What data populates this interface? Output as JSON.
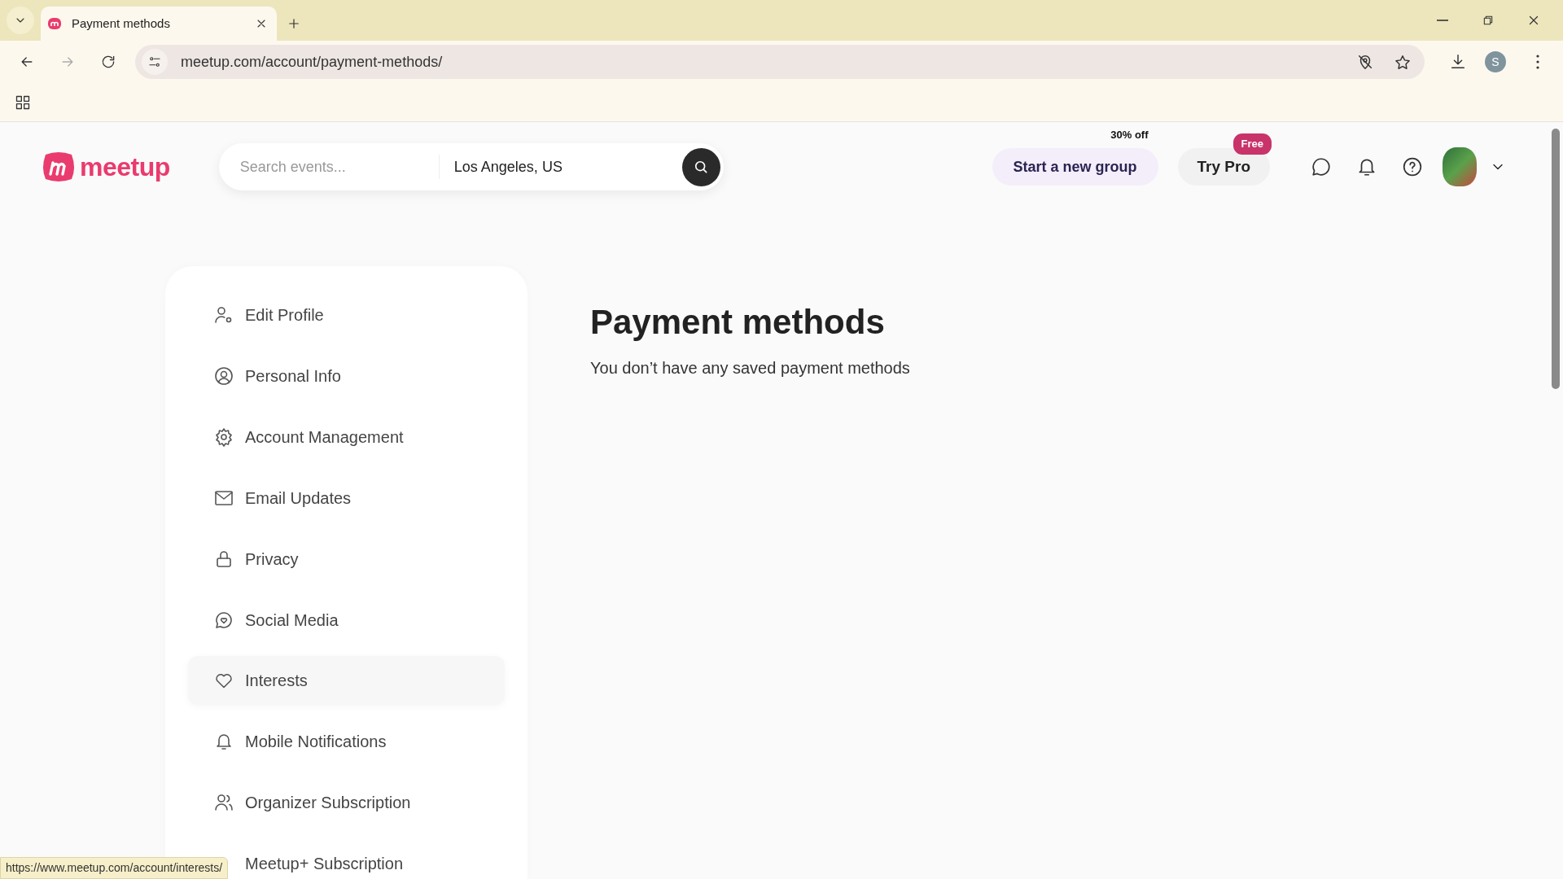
{
  "browser": {
    "tab": {
      "title": "Payment methods"
    },
    "address": "meetup.com/account/payment-methods/",
    "profile_initial": "S",
    "status_url": "https://www.meetup.com/account/interests/"
  },
  "header": {
    "logo": "meetup",
    "search": {
      "placeholder": "Search events..."
    },
    "location": "Los Angeles, US",
    "start_group": {
      "label": "Start a new group",
      "badge": "30% off"
    },
    "try_pro": {
      "label": "Try Pro",
      "badge": "Free"
    }
  },
  "sidebar": {
    "items": [
      {
        "label": "Edit Profile",
        "highlighted": false
      },
      {
        "label": "Personal Info",
        "highlighted": false
      },
      {
        "label": "Account Management",
        "highlighted": false
      },
      {
        "label": "Email Updates",
        "highlighted": false
      },
      {
        "label": "Privacy",
        "highlighted": false
      },
      {
        "label": "Social Media",
        "highlighted": false
      },
      {
        "label": "Interests",
        "highlighted": true
      },
      {
        "label": "Mobile Notifications",
        "highlighted": false
      },
      {
        "label": "Organizer Subscription",
        "highlighted": false
      },
      {
        "label": "Meetup+ Subscription",
        "highlighted": false
      }
    ]
  },
  "main": {
    "title": "Payment methods",
    "message": "You don’t have any saved payment methods"
  }
}
